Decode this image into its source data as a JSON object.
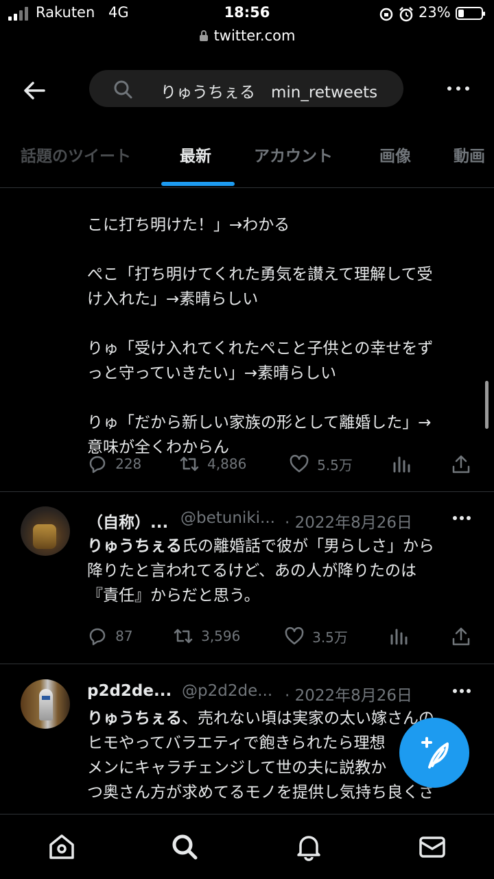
{
  "status_bar": {
    "carrier": "Rakuten",
    "network": "4G",
    "time": "18:56",
    "battery": "23%"
  },
  "browser": {
    "url": "twitter.com"
  },
  "search": {
    "query": "りゅうちぇる　min_retweets"
  },
  "tabs": [
    "話題のツイート",
    "最新",
    "アカウント",
    "画像",
    "動画"
  ],
  "tweet1": {
    "lines": [
      "こに打ち明けた！」→わかる",
      "",
      "ぺこ「打ち明けてくれた勇気を讃えて理解して受",
      "け入れた」→素晴らしい",
      "",
      "りゅ「受け入れてくれたぺこと子供との幸せをず",
      "っと守っていきたい」→素晴らしい",
      "",
      "りゅ「だから新しい家族の形として離婚した」→",
      "意味が全くわからん"
    ],
    "replies": "228",
    "retweets": "4,886",
    "likes": "5.5万"
  },
  "tweet2": {
    "name": "（自称）...",
    "handle": "@betuniki...",
    "date": "· 2022年8月26日",
    "bold": "りゅうちぇる",
    "line1": "氏の離婚話で彼が「男らしさ」から",
    "line2": "降りたと言われてるけど、あの人が降りたのは",
    "line3": "『責任』からだと思う。",
    "replies": "87",
    "retweets": "3,596",
    "likes": "3.5万"
  },
  "tweet3": {
    "name": "p2d2de...",
    "handle": "@p2d2de...",
    "date": "· 2022年8月26日",
    "bold": "りゅうちぇる",
    "line1": "、売れない頃は実家の太い嫁さんの",
    "line2": "ヒモやってバラエティで飽きられたら理想",
    "line3": "メンにキャラチェンジして世の夫に説教か",
    "line4": "つ奥さん方が求めてるモノを提供し気持ち良くさ"
  },
  "colors": {
    "accent": "#1d9bf0",
    "background": "#000000",
    "muted": "#71767b",
    "text": "#e7e9ea"
  },
  "icons": {
    "top": [
      "back-arrow-icon",
      "search-icon",
      "more-icon"
    ],
    "actions": [
      "reply-icon",
      "retweet-icon",
      "like-icon",
      "analytics-icon",
      "share-icon"
    ],
    "nav": [
      "home-icon",
      "explore-icon",
      "notifications-icon",
      "messages-icon"
    ],
    "fab": "compose-tweet-icon"
  }
}
